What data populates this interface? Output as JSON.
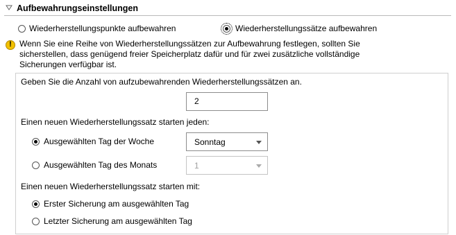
{
  "section": {
    "title": "Aufbewahrungseinstellungen"
  },
  "retention_mode": {
    "option_points": "Wiederherstellungspunkte aufbewahren",
    "option_sets": "Wiederherstellungssätze aufbewahren",
    "selected": "sets"
  },
  "warning": {
    "text": "Wenn Sie eine Reihe von Wiederherstellungssätzen zur Aufbewahrung festlegen, sollten Sie sicherstellen, dass genügend freier Speicherplatz dafür und für zwei zusätzliche vollständige Sicherungen verfügbar ist."
  },
  "count": {
    "label": "Geben Sie die Anzahl von aufzubewahrenden Wiederherstellungssätzen an.",
    "value": "2"
  },
  "start_every": {
    "label": "Einen neuen Wiederherstellungssatz starten jeden:",
    "weekday_label": "Ausgewählten Tag der Woche",
    "weekday_value": "Sonntag",
    "monthday_label": "Ausgewählten Tag des Monats",
    "monthday_value": "1",
    "selected": "weekday"
  },
  "start_with": {
    "label": "Einen neuen Wiederherstellungssatz starten mit:",
    "first_label": "Erster Sicherung am ausgewählten Tag",
    "last_label": "Letzter Sicherung am ausgewählten Tag",
    "selected": "first"
  }
}
